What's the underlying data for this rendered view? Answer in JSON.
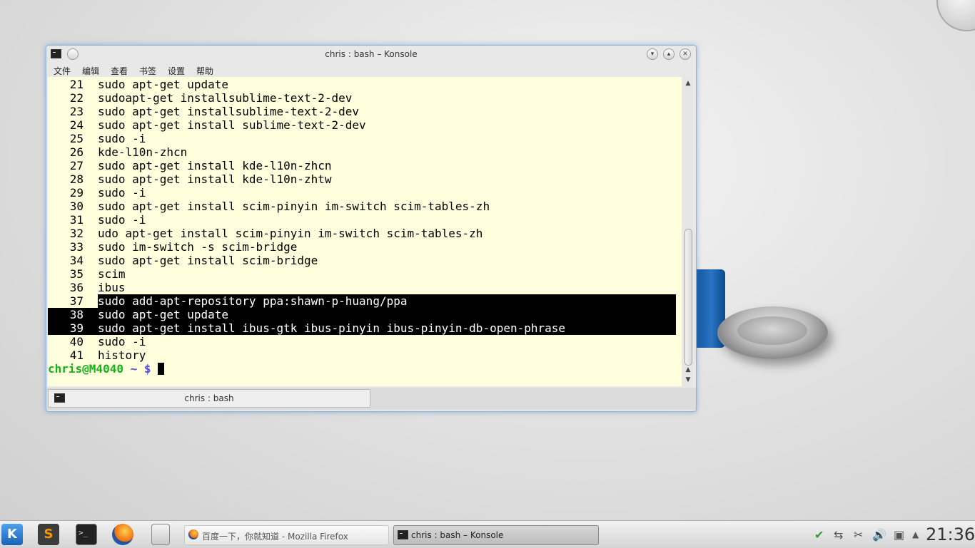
{
  "window": {
    "title": "chris : bash – Konsole",
    "menu": [
      "文件",
      "编辑",
      "查看",
      "书签",
      "设置",
      "帮助"
    ],
    "tab_label": "chris : bash"
  },
  "terminal": {
    "history": [
      {
        "num": "21",
        "cmd": "sudo apt-get update"
      },
      {
        "num": "22",
        "cmd": "sudoapt-get installsublime-text-2-dev"
      },
      {
        "num": "23",
        "cmd": "sudo apt-get installsublime-text-2-dev"
      },
      {
        "num": "24",
        "cmd": "sudo apt-get install sublime-text-2-dev"
      },
      {
        "num": "25",
        "cmd": "sudo -i"
      },
      {
        "num": "26",
        "cmd": "kde-l10n-zhcn"
      },
      {
        "num": "27",
        "cmd": "sudo apt-get install kde-l10n-zhcn"
      },
      {
        "num": "28",
        "cmd": "sudo apt-get install kde-l10n-zhtw"
      },
      {
        "num": "29",
        "cmd": "sudo -i"
      },
      {
        "num": "30",
        "cmd": "sudo apt-get install scim-pinyin im-switch scim-tables-zh"
      },
      {
        "num": "31",
        "cmd": "sudo -i"
      },
      {
        "num": "32",
        "cmd": "udo apt-get install scim-pinyin im-switch scim-tables-zh"
      },
      {
        "num": "33",
        "cmd": "sudo im-switch -s scim-bridge"
      },
      {
        "num": "34",
        "cmd": "sudo apt-get install scim-bridge"
      },
      {
        "num": "35",
        "cmd": "scim"
      },
      {
        "num": "36",
        "cmd": "ibus"
      },
      {
        "num": "37",
        "cmd": "sudo add-apt-repository ppa:shawn-p-huang/ppa"
      },
      {
        "num": "38",
        "cmd": "sudo apt-get update"
      },
      {
        "num": "39",
        "cmd": "sudo apt-get install ibus-gtk ibus-pinyin ibus-pinyin-db-open-phrase"
      },
      {
        "num": "40",
        "cmd": "sudo -i"
      },
      {
        "num": "41",
        "cmd": "history"
      }
    ],
    "prompt_user": "chris@M4040",
    "prompt_path": "~ $",
    "colors": {
      "background": "#ffffdd",
      "prompt_user": "#18b218",
      "prompt_path": "#4a4ad8",
      "selection": "#000000"
    }
  },
  "taskbar": {
    "tasks": [
      {
        "label": "百度一下，你就知道 - Mozilla Firefox",
        "active": false
      },
      {
        "label": "chris : bash – Konsole",
        "active": true
      }
    ],
    "launchers": [
      "kde-menu-icon",
      "sublime-text-icon",
      "konsole-icon",
      "firefox-icon",
      "file-manager-icon"
    ],
    "clock": "21:36"
  }
}
